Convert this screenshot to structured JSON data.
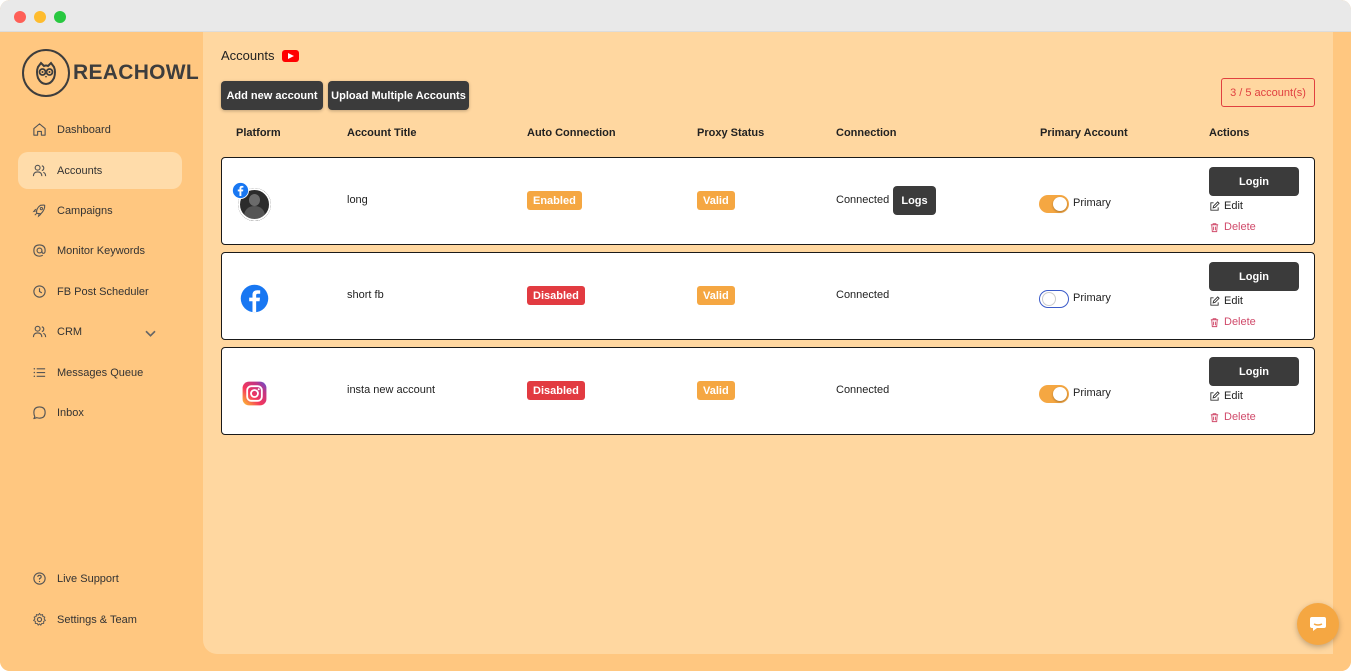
{
  "brand": {
    "name": "REACHOWL"
  },
  "sidebar": {
    "items": [
      {
        "label": "Dashboard",
        "icon": "home-icon"
      },
      {
        "label": "Accounts",
        "icon": "users-icon"
      },
      {
        "label": "Campaigns",
        "icon": "rocket-icon"
      },
      {
        "label": "Monitor Keywords",
        "icon": "at-icon"
      },
      {
        "label": "FB Post Scheduler",
        "icon": "clock-icon"
      },
      {
        "label": "CRM",
        "icon": "users-icon"
      },
      {
        "label": "Messages Queue",
        "icon": "list-icon"
      },
      {
        "label": "Inbox",
        "icon": "chat-bubble-icon"
      }
    ],
    "bottom_items": [
      {
        "label": "Live Support",
        "icon": "help-circle-icon"
      },
      {
        "label": "Settings & Team",
        "icon": "gear-icon"
      }
    ]
  },
  "header": {
    "title": "Accounts",
    "add_button": "Add new account",
    "upload_button": "Upload Multiple Accounts",
    "account_count": "3 / 5 account(s)"
  },
  "table": {
    "columns": [
      "Platform",
      "Account Title",
      "Auto Connection",
      "Proxy Status",
      "Connection",
      "Primary Account",
      "Actions"
    ],
    "rows": [
      {
        "platform": "facebook",
        "title": "long",
        "auto_connection": "Enabled",
        "proxy_status": "Valid",
        "connection": "Connected",
        "logs_label": "Logs",
        "primary_on": true,
        "primary_label": "Primary",
        "login": "Login",
        "edit": "Edit",
        "delete": "Delete"
      },
      {
        "platform": "facebook",
        "title": "short fb",
        "auto_connection": "Disabled",
        "proxy_status": "Valid",
        "connection": "Connected",
        "primary_on": false,
        "primary_label": "Primary",
        "login": "Login",
        "edit": "Edit",
        "delete": "Delete"
      },
      {
        "platform": "instagram",
        "title": "insta new account",
        "auto_connection": "Disabled",
        "proxy_status": "Valid",
        "connection": "Connected",
        "primary_on": true,
        "primary_label": "Primary",
        "login": "Login",
        "edit": "Edit",
        "delete": "Delete"
      }
    ]
  },
  "colors": {
    "sidebar_bg": "#ffc780",
    "main_bg": "#ffd7a0",
    "accent_orange": "#f5a742",
    "danger_red": "#e23b41",
    "dark_button": "#3b3b3b"
  }
}
